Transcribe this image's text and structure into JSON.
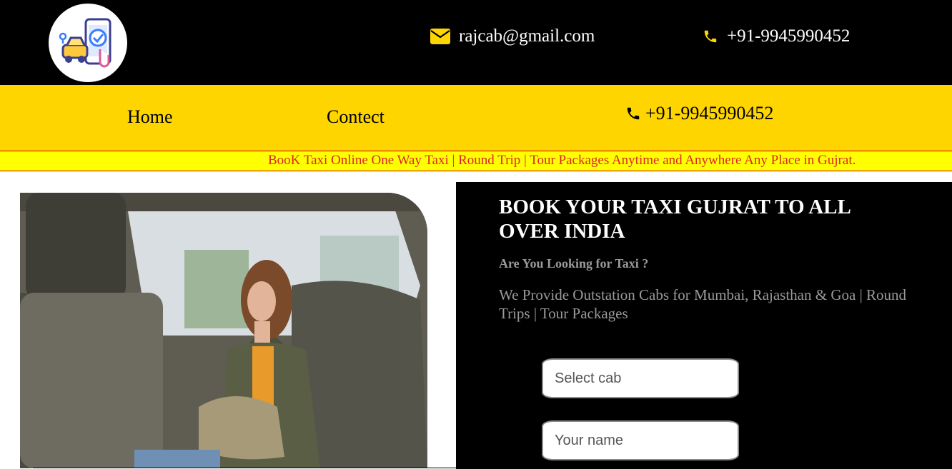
{
  "header": {
    "logo_icon": "taxi-app-logo-icon",
    "email": "rajcab@gmail.com",
    "email_icon": "envelope-icon",
    "phone": "+91-9945990452",
    "phone_icon": "phone-icon"
  },
  "nav": {
    "home": "Home",
    "contact": "Contect",
    "phone": "+91-9945990452",
    "phone_icon": "phone-icon"
  },
  "ticker": {
    "text": "BooK Taxi Online One Way Taxi | Round Trip | Tour Packages Anytime and Anywhere Any Place in Gujrat."
  },
  "booking": {
    "title": "BOOK YOUR TAXI GUJRAT TO ALL OVER INDIA",
    "subtitle": "Are You Looking for Taxi ?",
    "description": "We Provide Outstation Cabs for Mumbai, Rajasthan & Goa | Round Trips | Tour Packages",
    "cab_placeholder": "Select cab",
    "name_placeholder": "Your name"
  },
  "colors": {
    "top_bar": "#000000",
    "nav_bar": "#ffd500",
    "ticker_bg": "#ffff00",
    "ticker_text": "#e0232b",
    "icon_accent": "#ffd500"
  }
}
